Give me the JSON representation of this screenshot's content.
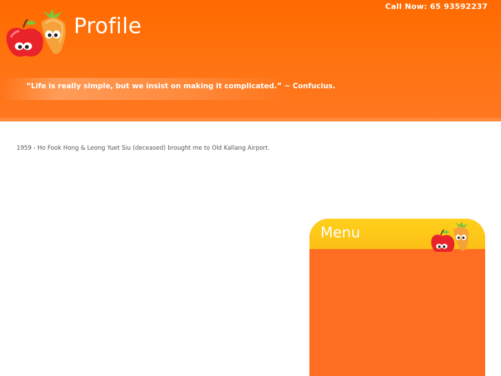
{
  "header": {
    "title": "Profile",
    "call_now": "Call Now: 65 93592237",
    "quote": "“Life is really simple, but we insist on making it complicated.” ~ Confucius."
  },
  "content": {
    "text": "1959 - Ho Fook Hong & Leong Yuet Siu (deceased) brought me to Old Kallang Airport."
  },
  "menu": {
    "title": "Menu"
  },
  "colors": {
    "header_orange": "#ff6a00",
    "menu_yellow": "#fcbf16",
    "menu_body": "#ff6d22"
  },
  "icons": [
    "apple-carrot-mascot-logo",
    "apple-carrot-mascot-menu-icon"
  ]
}
